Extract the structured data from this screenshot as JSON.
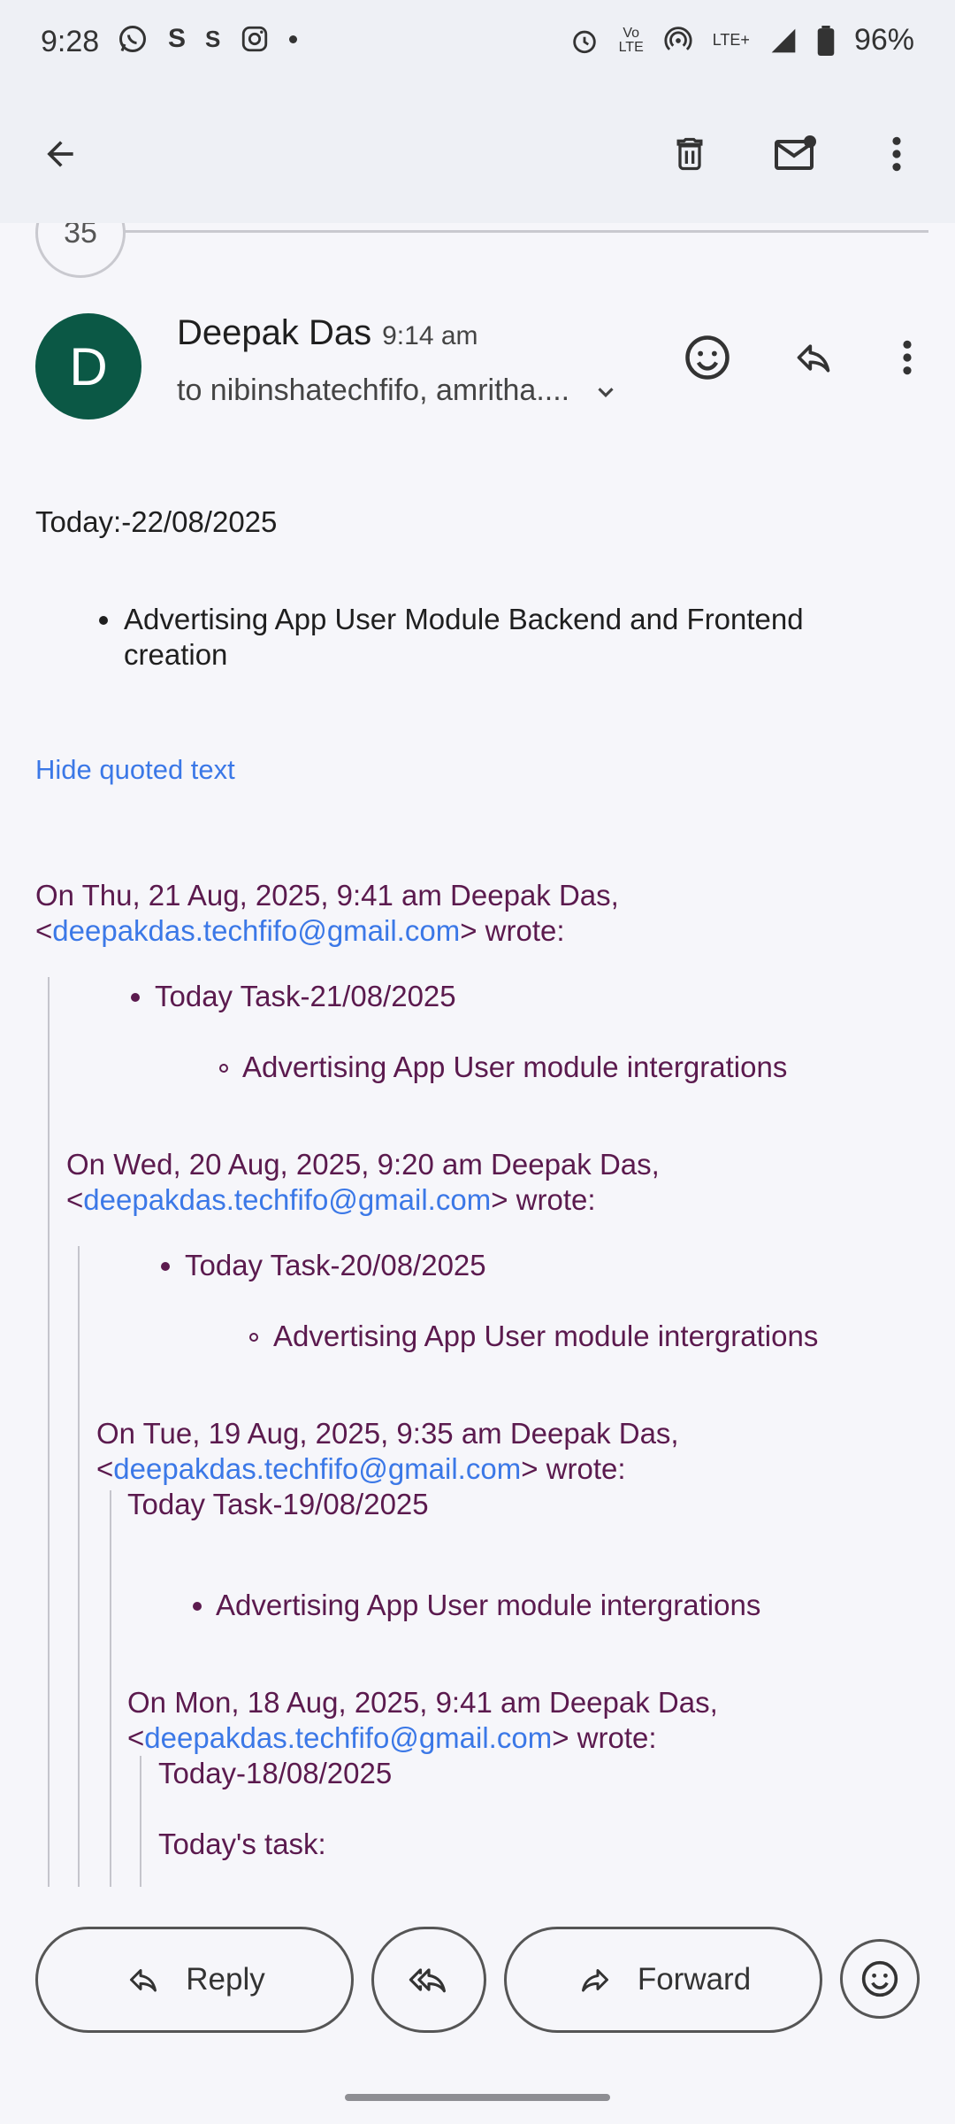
{
  "status_bar": {
    "time": "9:28",
    "battery": "96%",
    "network": "LTE+",
    "icons": [
      "whatsapp-icon",
      "s-icon",
      "s-icon",
      "instagram-icon",
      "dot-icon",
      "alarm-icon",
      "volte-icon",
      "hotspot-icon",
      "signal-icon",
      "battery-icon"
    ]
  },
  "toolbar": {
    "icons": [
      "back-arrow-icon",
      "delete-icon",
      "mark-unread-icon",
      "more-vert-icon"
    ]
  },
  "thread": {
    "count": "35"
  },
  "message": {
    "sender_initial": "D",
    "sender_name": "Deepak Das",
    "time": "9:14 am",
    "recipients": "to nibinshatechfifo, amritha....",
    "avatar_color": "#0b5845",
    "today_line": "Today:-22/08/2025",
    "bullet_1a": "Advertising App  User Module Backend and Frontend",
    "bullet_1b": "creation",
    "hide_quoted": "Hide quoted text"
  },
  "quotes": [
    {
      "header_1": "On Thu, 21 Aug, 2025, 9:41 am Deepak Das,",
      "email": "deepakdas.techfifo@gmail.com",
      "wrote": "wrote:",
      "task": "Today Task-21/08/2025",
      "sub": "Advertising App User module intergrations"
    },
    {
      "header_1": "On Wed, 20 Aug, 2025, 9:20 am Deepak Das,",
      "email": "deepakdas.techfifo@gmail.com",
      "wrote": "wrote:",
      "task": "Today Task-20/08/2025",
      "sub": "Advertising App User module intergrations"
    },
    {
      "header_1": "On Tue, 19 Aug, 2025, 9:35 am Deepak Das,",
      "email": "deepakdas.techfifo@gmail.com",
      "wrote": "wrote:",
      "task": "Today Task-19/08/2025",
      "sub": "Advertising App User module intergrations"
    },
    {
      "header_1": "On Mon, 18 Aug, 2025, 9:41 am Deepak Das,",
      "email": "deepakdas.techfifo@gmail.com",
      "wrote": "wrote:",
      "task": "Today-18/08/2025",
      "sub": "Today's task:"
    }
  ],
  "actions": {
    "reply": "Reply",
    "forward": "Forward"
  },
  "colors": {
    "quote_text": "#5b1a4e",
    "link": "#3b78e7"
  }
}
